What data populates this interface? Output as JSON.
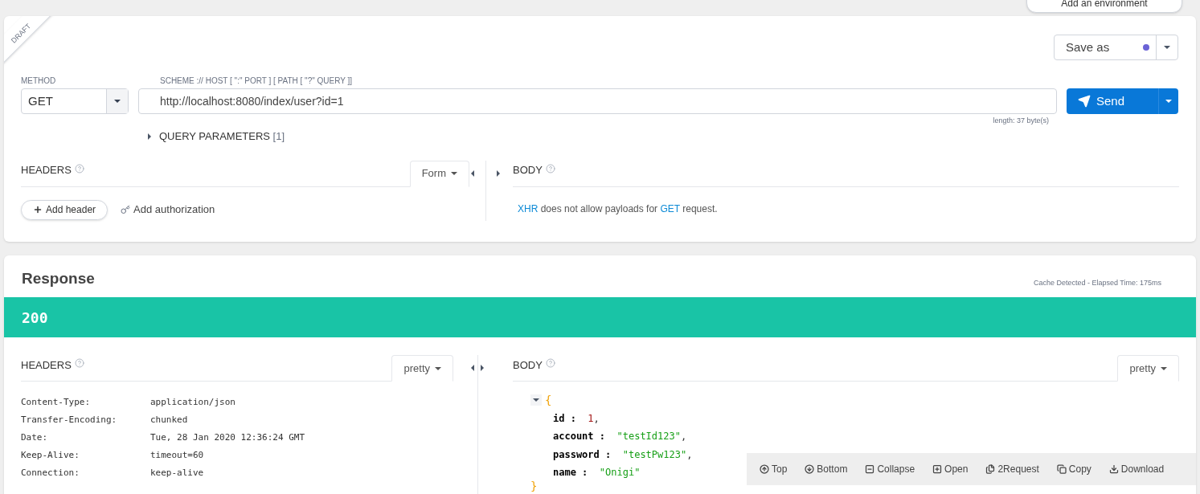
{
  "environment_tab": {
    "label": "Add an environment"
  },
  "request": {
    "badge": "DRAFT",
    "save": {
      "label": "Save as"
    },
    "method": {
      "label": "METHOD",
      "value": "GET"
    },
    "url": {
      "label": "SCHEME :// HOST [ \":\" PORT ] [ PATH [ \"?\" QUERY ]]",
      "value": "http://localhost:8080/index/user?id=1",
      "length": "length: 37 byte(s)"
    },
    "send": {
      "label": "Send"
    },
    "query_parameters": {
      "label": "QUERY PARAMETERS",
      "count": "[1]"
    },
    "headers": {
      "title": "HEADERS",
      "mode": "Form",
      "add_header": "Add header",
      "add_authorization": "Add authorization"
    },
    "body": {
      "title": "BODY",
      "message": "**XHR** does not allow payloads for **GET** request."
    }
  },
  "response": {
    "title": "Response",
    "timing": "Cache Detected - Elapsed Time: 175ms",
    "status": "200",
    "headers": {
      "title": "HEADERS",
      "mode": "pretty",
      "rows": [
        {
          "name": "Content-Type:",
          "value": "application/json"
        },
        {
          "name": "Transfer-Encoding:",
          "value": "chunked"
        },
        {
          "name": "Date:",
          "value": "Tue, 28 Jan 2020 12:36:24 GMT"
        },
        {
          "name": "Keep-Alive:",
          "value": "timeout=60"
        },
        {
          "name": "Connection:",
          "value": "keep-alive"
        }
      ]
    },
    "body": {
      "title": "BODY",
      "mode": "pretty",
      "open_brace": "{",
      "close_brace": "}",
      "expanded": true,
      "fields": [
        {
          "key": "id :",
          "value": "1",
          "comma": ",",
          "kind": "number"
        },
        {
          "key": "account :",
          "value": "\"testId123\"",
          "comma": ",",
          "kind": "string"
        },
        {
          "key": "password :",
          "value": "\"testPw123\"",
          "comma": ",",
          "kind": "string"
        },
        {
          "key": "name :",
          "value": "\"Onigi\"",
          "kind": "string"
        }
      ],
      "toolbar": [
        {
          "label": "Top"
        },
        {
          "label": "Bottom"
        },
        {
          "label": "Collapse"
        },
        {
          "label": "Open"
        },
        {
          "label": "2Request"
        },
        {
          "label": "Copy"
        },
        {
          "label": "Download"
        }
      ]
    }
  }
}
